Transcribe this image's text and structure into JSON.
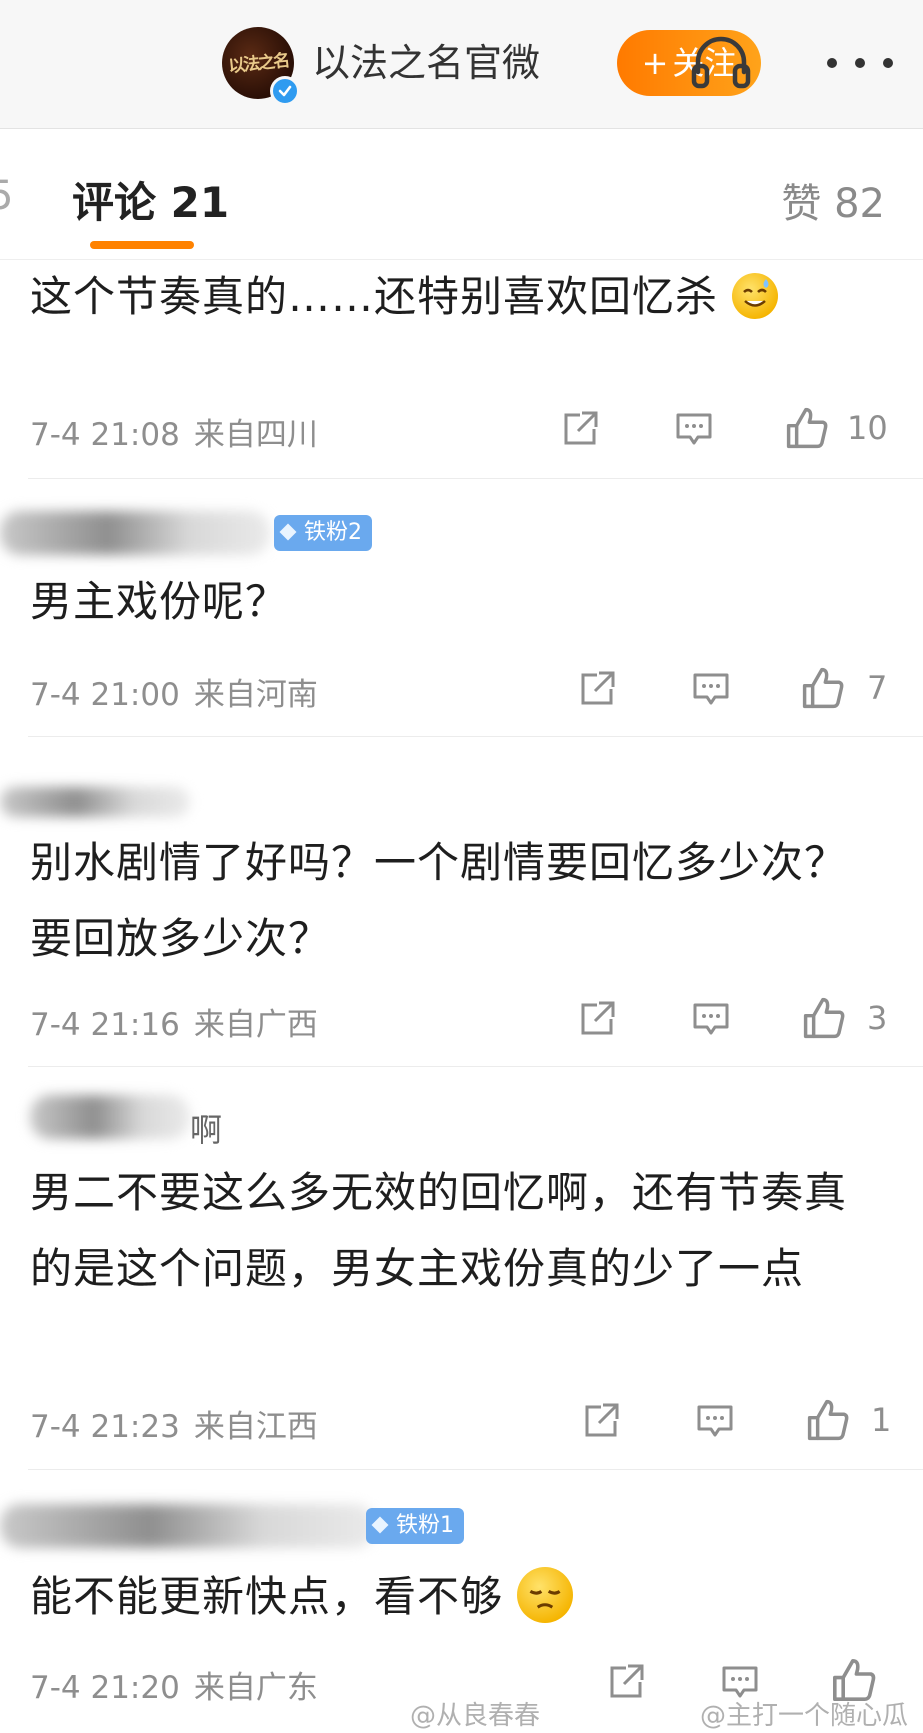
{
  "header": {
    "account_name": "以法之名官微",
    "avatar_text": "以法之名",
    "follow_label": "关注",
    "follow_plus": "+"
  },
  "tabs": {
    "cut_label": "5",
    "comments_label": "评论 21",
    "likes_label": "赞 82"
  },
  "comments": [
    {
      "text": "这个节奏真的……还特别喜欢回忆杀",
      "emoji": "sweat-smile-emoji",
      "time": "7-4 21:08",
      "location": "来自四川",
      "likes": "10"
    },
    {
      "badge": "铁粉2",
      "text": "男主戏份呢？",
      "time": "7-4 21:00",
      "location": "来自河南",
      "likes": "7"
    },
    {
      "text": "别水剧情了好吗？一个剧情要回忆多少次？要回放多少次？",
      "time": "7-4 21:16",
      "location": "来自广西",
      "likes": "3"
    },
    {
      "user_tail": "啊",
      "text": "男二不要这么多无效的回忆啊，还有节奏真的是这个问题，男女主戏份真的少了一点",
      "time": "7-4 21:23",
      "location": "来自江西",
      "likes": "1"
    },
    {
      "badge": "铁粉1",
      "text": "能不能更新快点，看不够",
      "emoji": "pensive-emoji",
      "time": "7-4 21:20",
      "location": "来自广东",
      "likes": ""
    }
  ],
  "watermarks": [
    "@从良春春",
    "@主打一个随心瓜"
  ],
  "colors": {
    "accent": "#ff8200",
    "badge": "#6aa9ee",
    "verified": "#2f9bf0",
    "meta_gray": "#8e8e8e"
  }
}
